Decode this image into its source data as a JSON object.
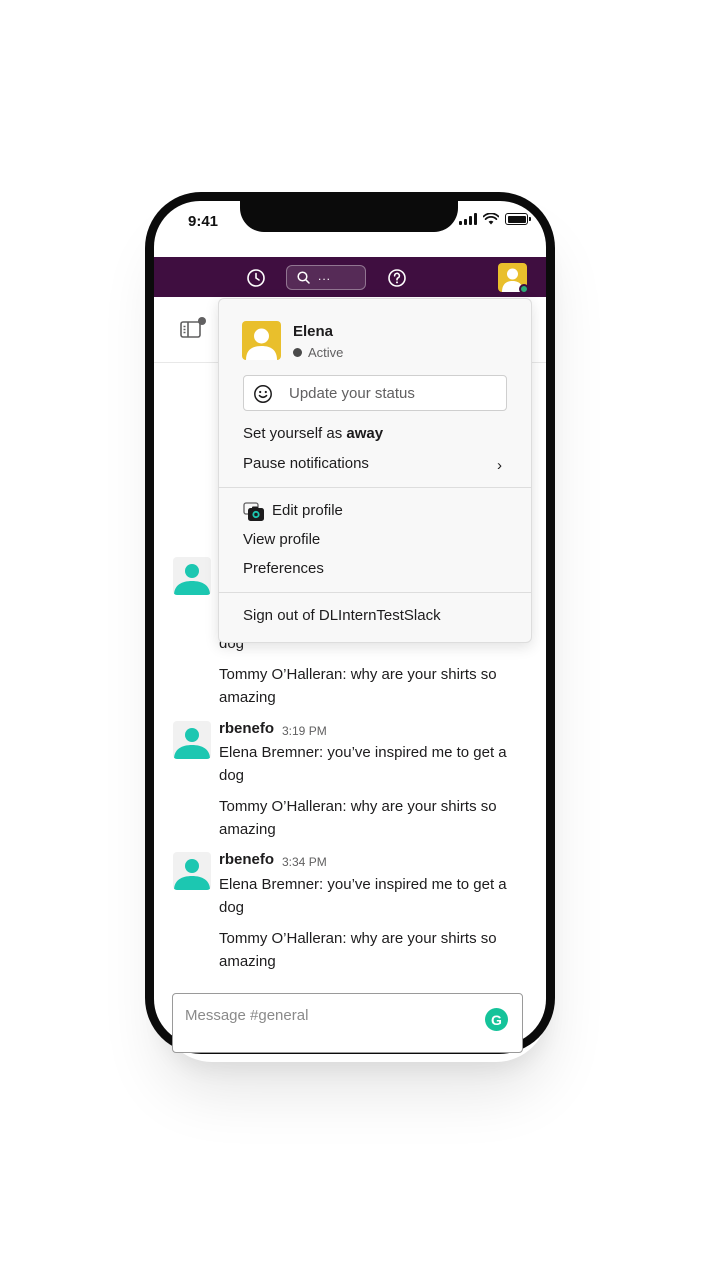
{
  "status_bar": {
    "time": "9:41"
  },
  "topbar": {
    "search_placeholder": "...",
    "icons": [
      "history-icon",
      "search-icon",
      "help-icon"
    ]
  },
  "user_menu": {
    "name": "Elena",
    "presence": "Active",
    "status_placeholder": "Update your status",
    "set_away_prefix": "Set yourself as ",
    "set_away_bold": "away",
    "pause_notifications": "Pause notifications",
    "pause_chevron": "›",
    "edit_profile": "Edit profile",
    "view_profile": "View profile",
    "preferences": "Preferences",
    "sign_out": "Sign out of DLInternTestSlack"
  },
  "messages": [
    {
      "partial_text": "dog",
      "second": "Tommy O’Halleran: why are your shirts so amazing"
    },
    {
      "author": "rbenefo",
      "time": "3:19 PM",
      "text": "Elena Bremner: you’ve inspired me to get a dog",
      "second": "Tommy O’Halleran: why are your shirts so amazing"
    },
    {
      "author": "rbenefo",
      "time": "3:34 PM",
      "text": "Elena Bremner: you’ve inspired me to get a dog",
      "second": "Tommy O’Halleran: why are your shirts so amazing"
    }
  ],
  "composer": {
    "placeholder": "Message #general",
    "grammarly_letter": "G"
  },
  "colors": {
    "topbar": "#3f0e40",
    "avatar_teal": "#1cc7b1",
    "avatar_yellow": "#e9bf2c",
    "grammarly": "#15c39a"
  }
}
